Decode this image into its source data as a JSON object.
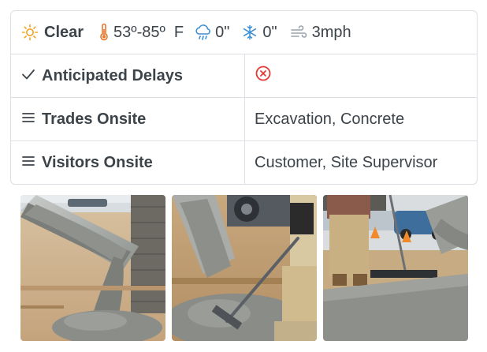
{
  "weather": {
    "condition": "Clear",
    "temperature": "53º-85º  F",
    "rain": "0\"",
    "snow": "0\"",
    "wind": "3mph",
    "icons": [
      "sun-icon",
      "thermometer-icon",
      "rain-cloud-icon",
      "snowflake-icon",
      "wind-icon"
    ]
  },
  "rows": [
    {
      "icon": "checkmark-icon",
      "label": "Anticipated Delays",
      "value_icon": "x-circle-icon"
    },
    {
      "icon": "list-icon",
      "label": "Trades Onsite",
      "value": "Excavation, Concrete"
    },
    {
      "icon": "list-icon",
      "label": "Visitors Onsite",
      "value": "Customer, Site Supervisor"
    }
  ],
  "colors": {
    "sun": "#f4a21c",
    "thermometer": "#e8762b",
    "rain": "#3a8fd6",
    "snow": "#3a8fd6",
    "wind": "#9aa3ab",
    "delay_x": "#e53935",
    "border": "#dcdfe3",
    "text": "#3c4349"
  },
  "photos": [
    "concrete-chute-photo",
    "concrete-pour-rake-photo",
    "concrete-screed-photo"
  ]
}
